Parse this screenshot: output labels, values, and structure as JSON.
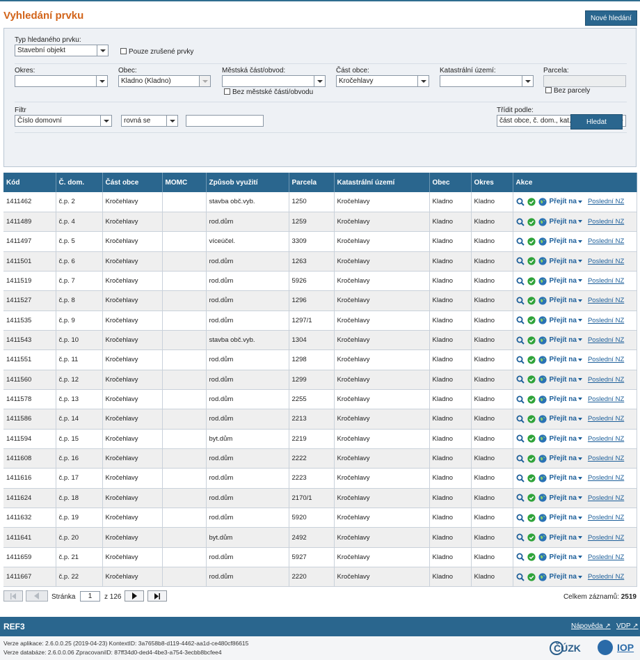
{
  "page": {
    "title": "Vyhledání prvku",
    "new_search": "Nové hledání"
  },
  "filter": {
    "type_label": "Typ hledaného prvku:",
    "type_value": "Stavební objekt",
    "only_cancelled": "Pouze zrušené prvky",
    "okres_label": "Okres:",
    "okres_value": "",
    "obec_label": "Obec:",
    "obec_value": "Kladno (Kladno)",
    "mestska_label": "Městská část/obvod:",
    "mestska_value": "",
    "no_mestska": "Bez městské části/obvodu",
    "cast_label": "Část obce:",
    "cast_value": "Kročehlavy",
    "katastr_label": "Katastrální území:",
    "katastr_value": "",
    "parcela_label": "Parcela:",
    "no_parcela": "Bez parcely",
    "filtr_label": "Filtr",
    "filtr_field": "Číslo domovní",
    "filtr_op": "rovná se",
    "filtr_value": "",
    "sort_label": "Třídit podle:",
    "sort_value": "část obce, č. dom., kat. území, č. parc...",
    "search_button": "Hledat"
  },
  "table": {
    "columns": [
      "Kód",
      "Č. dom.",
      "Část obce",
      "MOMC",
      "Způsob využití",
      "Parcela",
      "Katastrální území",
      "Obec",
      "Okres",
      "Akce"
    ],
    "action_goto": "Přejít na",
    "action_last": "Poslední NZ",
    "rows": [
      [
        "1411462",
        "č.p. 2",
        "Kročehlavy",
        "",
        "stavba obč.vyb.",
        "1250",
        "Kročehlavy",
        "Kladno",
        "Kladno"
      ],
      [
        "1411489",
        "č.p. 4",
        "Kročehlavy",
        "",
        "rod.dům",
        "1259",
        "Kročehlavy",
        "Kladno",
        "Kladno"
      ],
      [
        "1411497",
        "č.p. 5",
        "Kročehlavy",
        "",
        "víceúčel.",
        "3309",
        "Kročehlavy",
        "Kladno",
        "Kladno"
      ],
      [
        "1411501",
        "č.p. 6",
        "Kročehlavy",
        "",
        "rod.dům",
        "1263",
        "Kročehlavy",
        "Kladno",
        "Kladno"
      ],
      [
        "1411519",
        "č.p. 7",
        "Kročehlavy",
        "",
        "rod.dům",
        "5926",
        "Kročehlavy",
        "Kladno",
        "Kladno"
      ],
      [
        "1411527",
        "č.p. 8",
        "Kročehlavy",
        "",
        "rod.dům",
        "1296",
        "Kročehlavy",
        "Kladno",
        "Kladno"
      ],
      [
        "1411535",
        "č.p. 9",
        "Kročehlavy",
        "",
        "rod.dům",
        "1297/1",
        "Kročehlavy",
        "Kladno",
        "Kladno"
      ],
      [
        "1411543",
        "č.p. 10",
        "Kročehlavy",
        "",
        "stavba obč.vyb.",
        "1304",
        "Kročehlavy",
        "Kladno",
        "Kladno"
      ],
      [
        "1411551",
        "č.p. 11",
        "Kročehlavy",
        "",
        "rod.dům",
        "1298",
        "Kročehlavy",
        "Kladno",
        "Kladno"
      ],
      [
        "1411560",
        "č.p. 12",
        "Kročehlavy",
        "",
        "rod.dům",
        "1299",
        "Kročehlavy",
        "Kladno",
        "Kladno"
      ],
      [
        "1411578",
        "č.p. 13",
        "Kročehlavy",
        "",
        "rod.dům",
        "2255",
        "Kročehlavy",
        "Kladno",
        "Kladno"
      ],
      [
        "1411586",
        "č.p. 14",
        "Kročehlavy",
        "",
        "rod.dům",
        "2213",
        "Kročehlavy",
        "Kladno",
        "Kladno"
      ],
      [
        "1411594",
        "č.p. 15",
        "Kročehlavy",
        "",
        "byt.dům",
        "2219",
        "Kročehlavy",
        "Kladno",
        "Kladno"
      ],
      [
        "1411608",
        "č.p. 16",
        "Kročehlavy",
        "",
        "rod.dům",
        "2222",
        "Kročehlavy",
        "Kladno",
        "Kladno"
      ],
      [
        "1411616",
        "č.p. 17",
        "Kročehlavy",
        "",
        "rod.dům",
        "2223",
        "Kročehlavy",
        "Kladno",
        "Kladno"
      ],
      [
        "1411624",
        "č.p. 18",
        "Kročehlavy",
        "",
        "rod.dům",
        "2170/1",
        "Kročehlavy",
        "Kladno",
        "Kladno"
      ],
      [
        "1411632",
        "č.p. 19",
        "Kročehlavy",
        "",
        "rod.dům",
        "5920",
        "Kročehlavy",
        "Kladno",
        "Kladno"
      ],
      [
        "1411641",
        "č.p. 20",
        "Kročehlavy",
        "",
        "byt.dům",
        "2492",
        "Kročehlavy",
        "Kladno",
        "Kladno"
      ],
      [
        "1411659",
        "č.p. 21",
        "Kročehlavy",
        "",
        "rod.dům",
        "5927",
        "Kročehlavy",
        "Kladno",
        "Kladno"
      ],
      [
        "1411667",
        "č.p. 22",
        "Kročehlavy",
        "",
        "rod.dům",
        "2220",
        "Kročehlavy",
        "Kladno",
        "Kladno"
      ]
    ]
  },
  "pager": {
    "page_label": "Stránka",
    "page_value": "1",
    "of_text": "z 126",
    "total_label": "Celkem záznamů:",
    "total_value": "2519"
  },
  "footer": {
    "app": "REF3",
    "help": "Nápověda",
    "vdp": "VDP",
    "version_app": "Verze aplikace: 2.6.0.0.25 (2019-04-23) KontextID: 3a7658b8-d119-4462-aa1d-ce480cf86615",
    "version_db": "Verze databáze: 2.6.0.0.06 ZpracovaniID: 87ff34d0-ded4-4be3-a754-3ecbb8bcfee4",
    "logo_cuzk": "ČÚZK",
    "logo_iop": "IOP"
  },
  "colors": {
    "header_blue": "#2a668e",
    "title_orange": "#d2641a",
    "link_blue": "#1d5f9a",
    "ok_green": "#2fa33a"
  }
}
